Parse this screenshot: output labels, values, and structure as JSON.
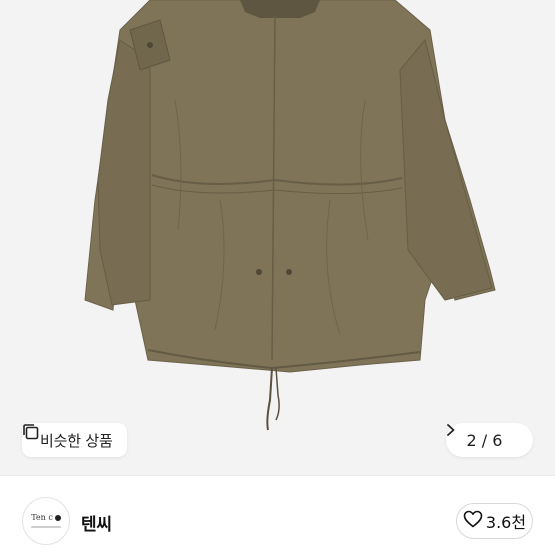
{
  "product": {
    "image_alt": "khaki parka",
    "photo_background": "#f3f3f3",
    "garment_color": "#7f7457"
  },
  "similar_button": {
    "icon": "similar-items-icon",
    "label": "비슷한 상품"
  },
  "pager": {
    "current": 2,
    "total": 6,
    "label": "2 / 6",
    "icon": "chevron-right-icon"
  },
  "seller": {
    "avatar_text": "Ten c",
    "name": "텐씨"
  },
  "like": {
    "icon": "heart-icon",
    "count": "3.6천"
  }
}
